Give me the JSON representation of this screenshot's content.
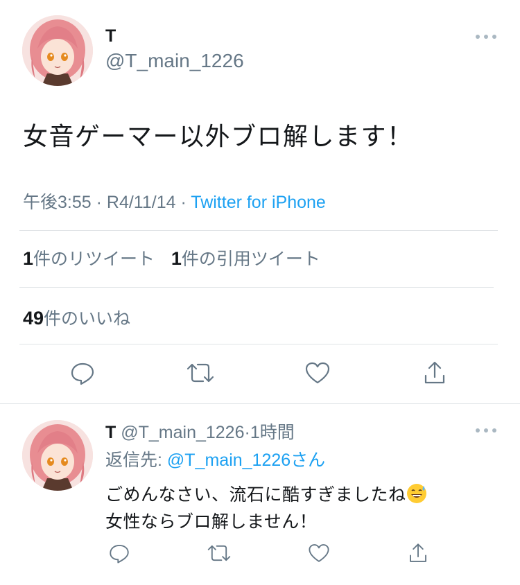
{
  "main_tweet": {
    "author_name": "T",
    "author_handle": "@T_main_1226",
    "text": "女音ゲーマー以外ブロ解します！",
    "time": "午後3:55",
    "separator": "·",
    "date": "R4/11/14",
    "source": "Twitter for iPhone",
    "retweet_count": "1",
    "retweet_label": "件のリツイート",
    "quote_count": "1",
    "quote_label": "件の引用ツイート",
    "like_count": "49",
    "like_label": "件のいいね"
  },
  "actions": {
    "reply_icon": "speech-bubble-icon",
    "retweet_icon": "retweet-arrows-icon",
    "like_icon": "heart-icon",
    "share_icon": "share-upload-icon"
  },
  "reply_tweet": {
    "author_name": "T",
    "author_handle": "@T_main_1226",
    "separator": "·",
    "time_ago": "1時間",
    "reply_to_label": "返信先:",
    "reply_to_handle": "@T_main_1226",
    "reply_to_suffix": "さん",
    "line1": "ごめんなさい、流石に酷すぎましたね",
    "line1_emoji": "grinning-sweat-emoji",
    "line2": "女性ならブロ解しません！"
  },
  "colors": {
    "link": "#1da1f2",
    "secondary_text": "#657786",
    "primary_text": "#14171a",
    "divider": "#dfe3e6"
  }
}
